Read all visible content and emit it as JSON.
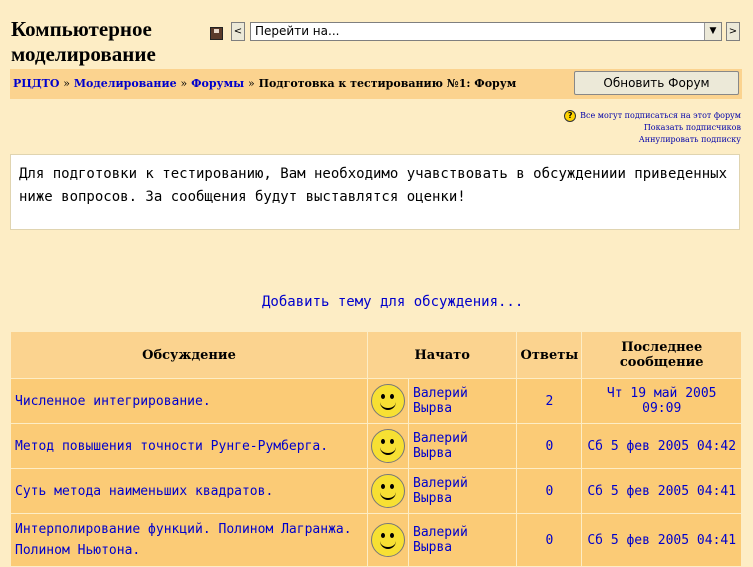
{
  "course": {
    "title_line1": "Компьютерное",
    "title_line2": "моделирование"
  },
  "jump": {
    "select_value": "Перейти на...",
    "prev": "<",
    "next": ">",
    "arrow": "▼"
  },
  "breadcrumb": {
    "home": "РЦДТО",
    "course": "Моделирование",
    "forums": "Форумы",
    "current": "Подготовка к тестированию №1: Форум",
    "sep": "»"
  },
  "update_button": "Обновить Форум",
  "subscribe": {
    "everyone": "Все могут подписаться на этот форум",
    "show": "Показать подписчиков",
    "cancel": "Аннулировать подписку"
  },
  "intro_text": "Для подготовки к тестированию, Вам необходимо учавствовать в обсуждениии приведенных ниже вопросов. За сообщения будут выставлятся оценки!",
  "add_topic": "Добавить тему для обсуждения...",
  "table": {
    "headers": {
      "discussion": "Обсуждение",
      "started": "Начато",
      "replies": "Ответы",
      "last_line1": "Последнее",
      "last_line2": "сообщение"
    },
    "rows": [
      {
        "topic": "Численное интегрирование.",
        "author": "Валерий Вырва",
        "replies": "2",
        "last": "Чт 19 май 2005 09:09"
      },
      {
        "topic": "Метод повышения точности Рунге-Румберга.",
        "author": "Валерий Вырва",
        "replies": "0",
        "last": "Сб 5 фев 2005 04:42"
      },
      {
        "topic": "Суть метода наименьших квадратов.",
        "author": "Валерий Вырва",
        "replies": "0",
        "last": "Сб 5 фев 2005 04:41"
      },
      {
        "topic": "Интерполирование функций. Полином Лагранжа. Полином Ньютона.",
        "author": "Валерий Вырва",
        "replies": "0",
        "last": "Сб 5 фев 2005 04:41"
      }
    ]
  }
}
